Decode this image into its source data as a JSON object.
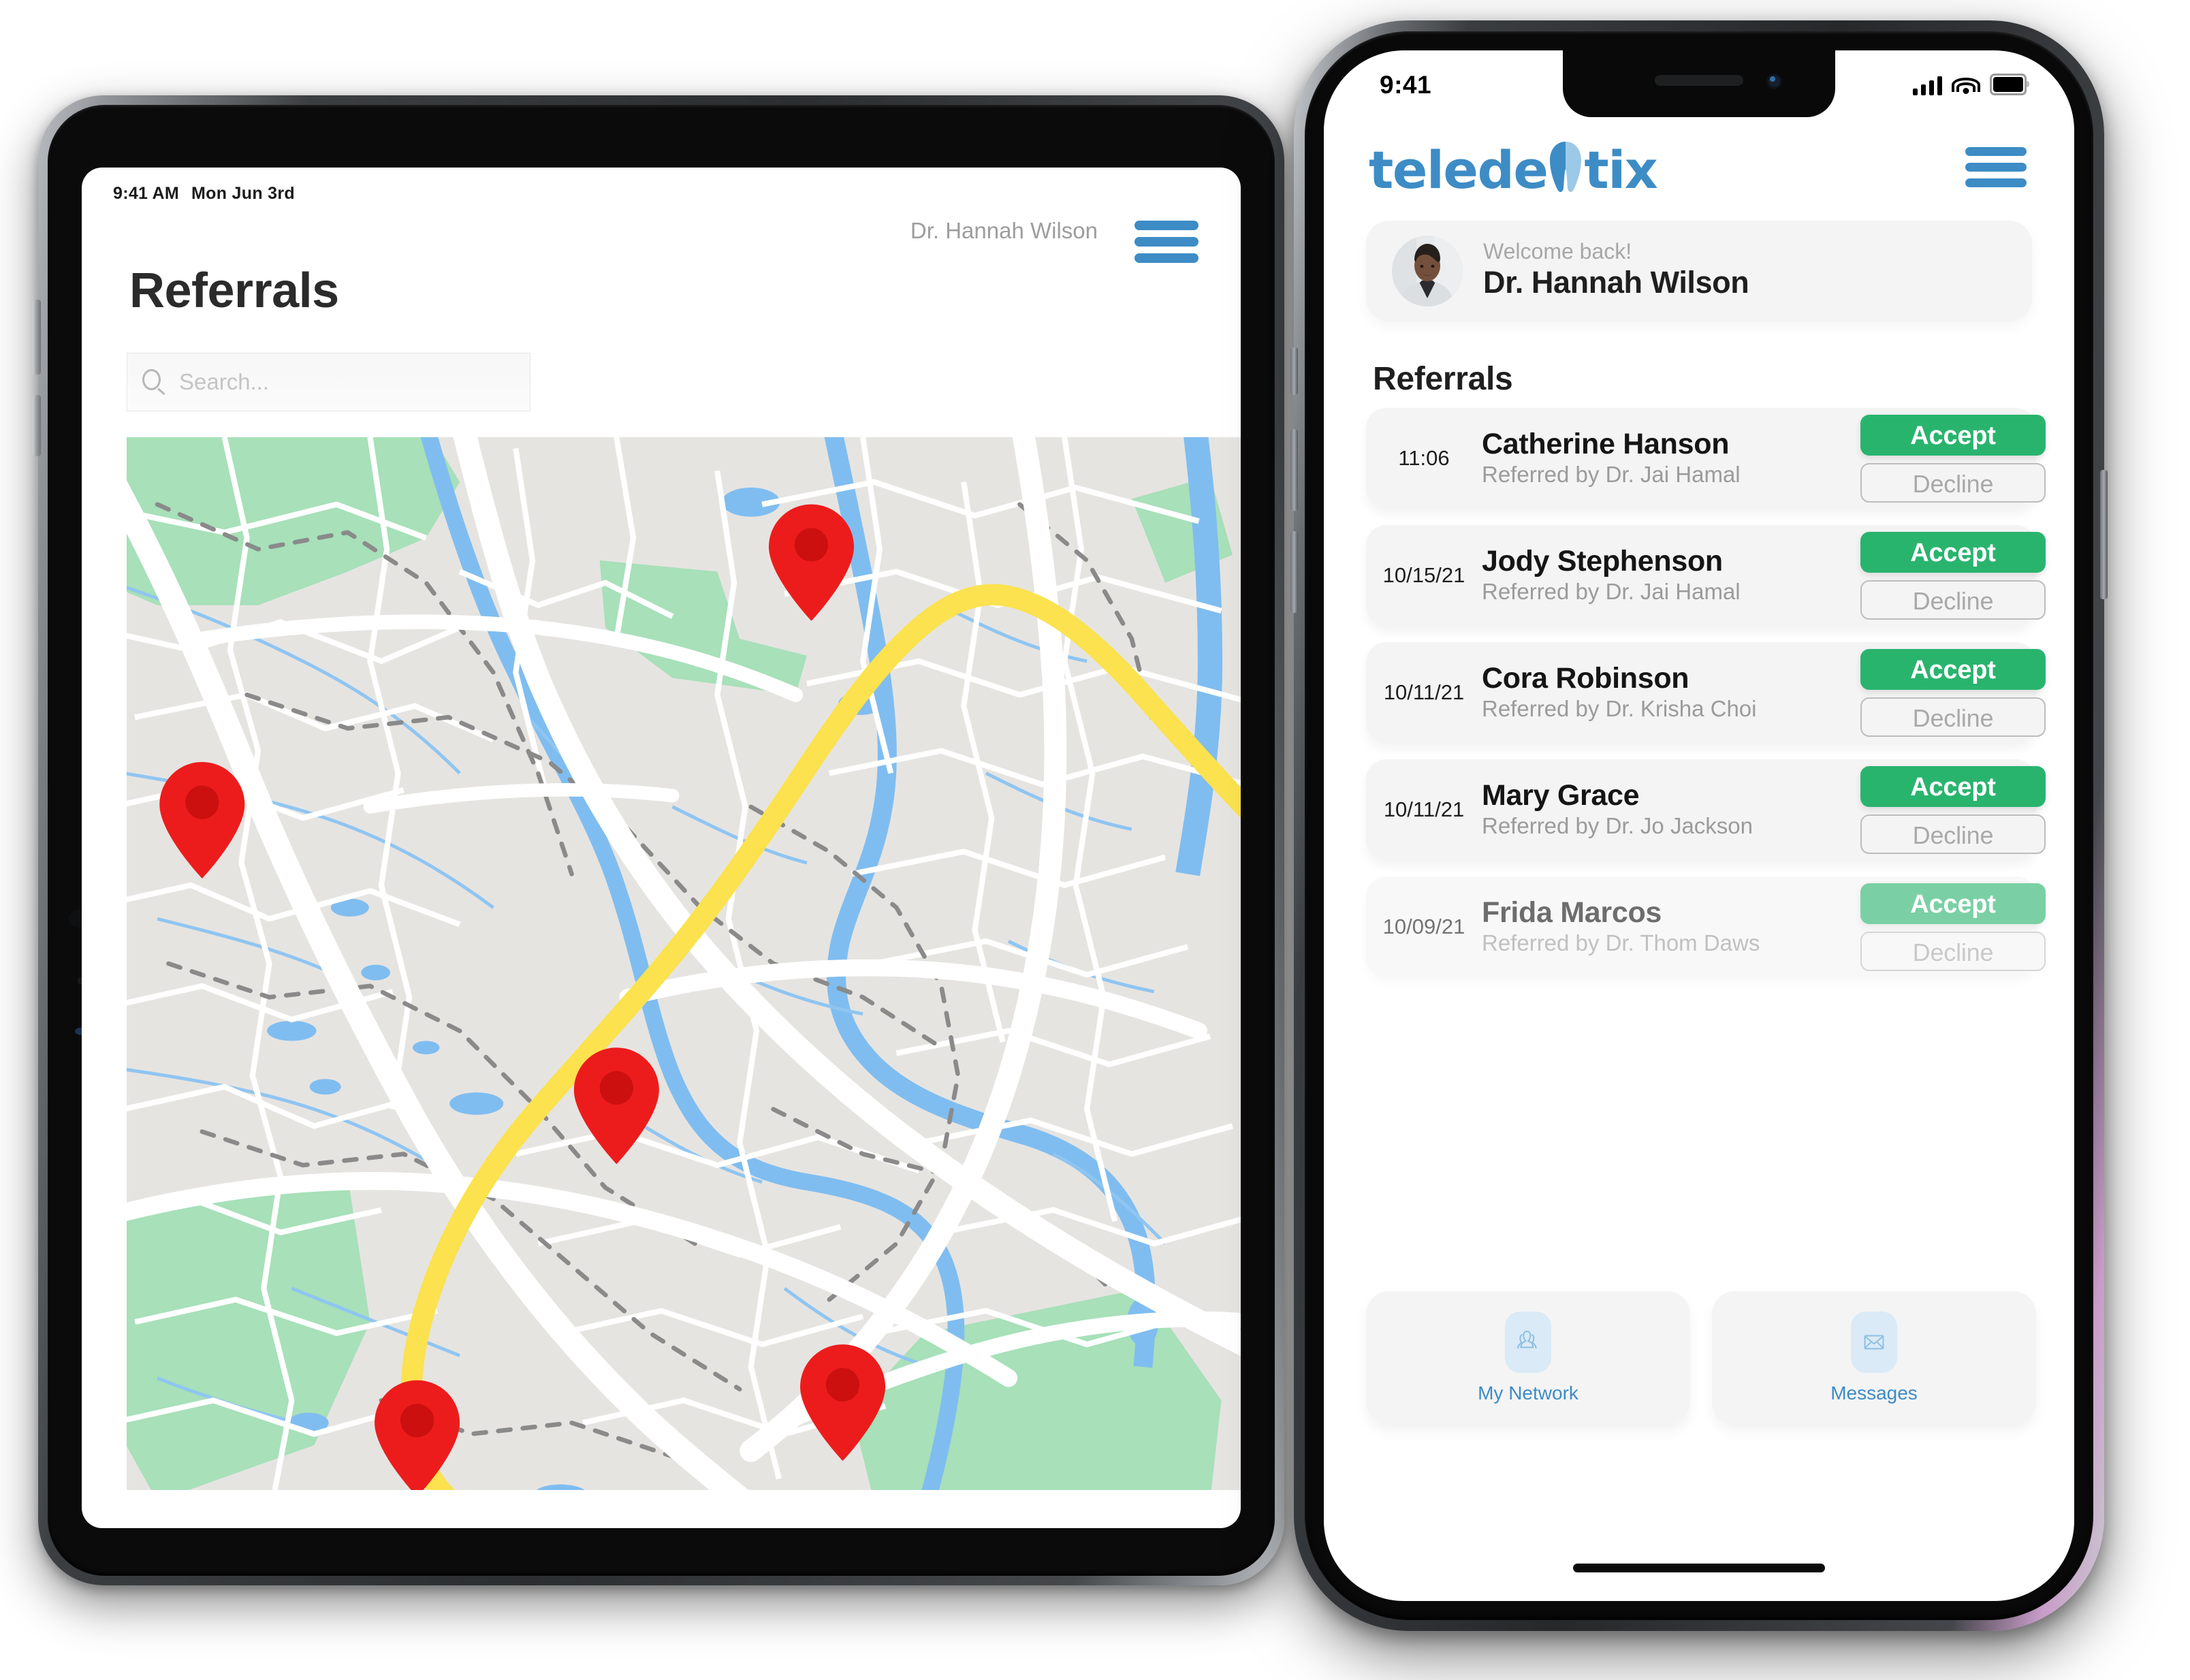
{
  "tablet": {
    "status_time": "9:41 AM",
    "status_date": "Mon Jun 3rd",
    "user_name": "Dr. Hannah Wilson",
    "page_title": "Referrals",
    "search_placeholder": "Search...",
    "menu_icon": "hamburger-icon",
    "search_icon": "search-icon",
    "accent_blue": "#3d8cc5",
    "map": {
      "pin_icon": "map-pin-icon",
      "pin_count": 5,
      "pin_color": "#ed1c1c",
      "land_color": "#e6e4e1",
      "park_color": "#a7e0b9",
      "water_color": "#7fbdf0",
      "road_color": "#ffffff",
      "highway_color": "#fbe24e",
      "trail_color": "#8a8a8a"
    }
  },
  "phone": {
    "status_time": "9:41",
    "status_icons": [
      "signal-bars-icon",
      "wifi-icon",
      "battery-icon"
    ],
    "logo_text_before": "teledе",
    "logo_tooth_icon": "tooth-icon",
    "logo_text_after": "tix",
    "logo_full": "teledentix",
    "menu_icon": "hamburger-icon",
    "accent_blue": "#3d8cc5",
    "welcome": {
      "greeting": "Welcome back!",
      "name": "Dr. Hannah Wilson",
      "avatar_icon": "avatar-photo"
    },
    "referrals_heading": "Referrals",
    "accept_label": "Accept",
    "decline_label": "Decline",
    "accept_color": "#29b46e",
    "referrals": [
      {
        "date": "11:06",
        "patient": "Catherine Hanson",
        "referrer": "Referred by Dr. Jai Hamal",
        "faded": false
      },
      {
        "date": "10/15/21",
        "patient": "Jody Stephenson",
        "referrer": "Referred by Dr. Jai Hamal",
        "faded": false
      },
      {
        "date": "10/11/21",
        "patient": "Cora Robinson",
        "referrer": "Referred by Dr. Krisha Choi",
        "faded": false
      },
      {
        "date": "10/11/21",
        "patient": "Mary Grace",
        "referrer": "Referred by Dr. Jo Jackson",
        "faded": false
      },
      {
        "date": "10/09/21",
        "patient": "Frida Marcos",
        "referrer": "Referred by Dr. Thom Daws",
        "faded": true
      }
    ],
    "tiles": [
      {
        "label": "My Network",
        "icon": "people-group-icon"
      },
      {
        "label": "Messages",
        "icon": "envelope-icon"
      }
    ]
  }
}
